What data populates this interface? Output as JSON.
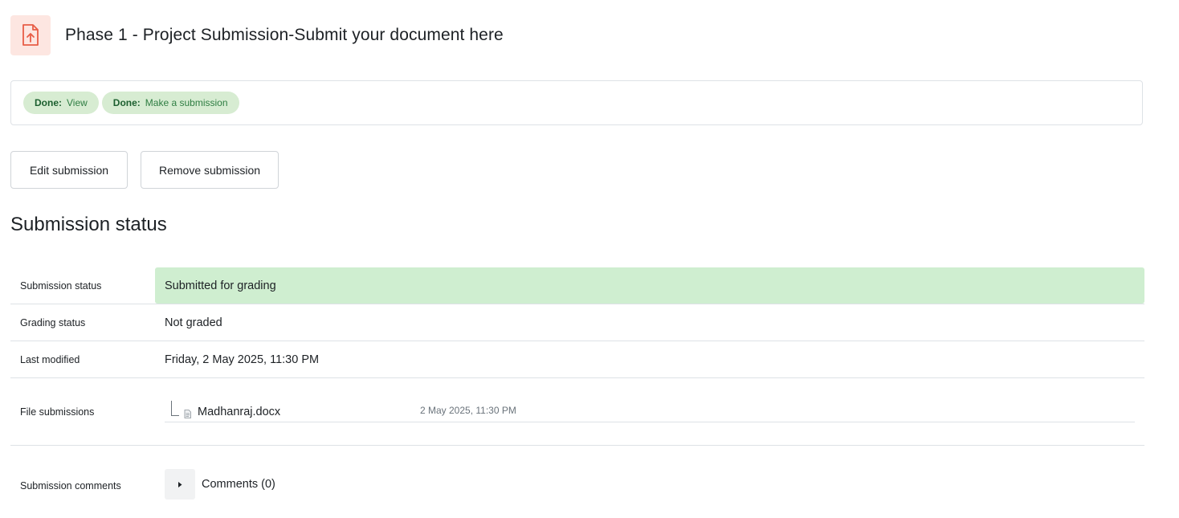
{
  "header": {
    "title": "Phase 1 - Project Submission-Submit your document here",
    "icon": "assignment-upload-icon",
    "icon_color": "#e85d46",
    "icon_bg": "#fde6e1"
  },
  "completion": [
    {
      "status": "Done:",
      "label": "View"
    },
    {
      "status": "Done:",
      "label": "Make a submission"
    }
  ],
  "actions": {
    "edit_label": "Edit submission",
    "remove_label": "Remove submission"
  },
  "section_title": "Submission status",
  "status": {
    "submission": {
      "label": "Submission status",
      "value": "Submitted for grading",
      "color": "#cfeed0"
    },
    "grading": {
      "label": "Grading status",
      "value": "Not graded"
    },
    "modified": {
      "label": "Last modified",
      "value": "Friday, 2 May 2025, 11:30 PM"
    },
    "files": {
      "label": "File submissions",
      "items": [
        {
          "name": "Madhanraj.docx",
          "date": "2 May 2025, 11:30 PM",
          "icon": "document-icon"
        }
      ]
    },
    "comments": {
      "label": "Submission comments",
      "toggle_label": "Comments (0)"
    }
  }
}
